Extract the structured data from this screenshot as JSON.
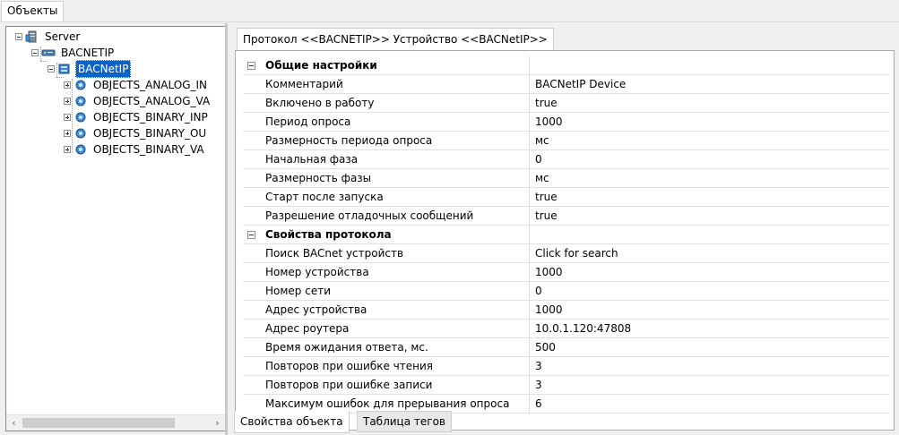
{
  "top_tab": {
    "label": "Объекты"
  },
  "tree": {
    "root": "Server",
    "protocol": "BACNETIP",
    "device": "BACNetIP",
    "children": [
      "OBJECTS_ANALOG_IN",
      "OBJECTS_ANALOG_VA",
      "OBJECTS_BINARY_INP",
      "OBJECTS_BINARY_OU",
      "OBJECTS_BINARY_VA"
    ]
  },
  "right": {
    "tab_label": "Протокол <<BACNETIP>> Устройство <<BACNetIP>>",
    "sections": [
      {
        "title": "Общие настройки",
        "rows": [
          {
            "key": "Комментарий",
            "value": "BACNetIP Device"
          },
          {
            "key": "Включено в работу",
            "value": "true"
          },
          {
            "key": "Период опроса",
            "value": "1000"
          },
          {
            "key": "Размерность периода опроса",
            "value": "мс"
          },
          {
            "key": "Начальная фаза",
            "value": "0"
          },
          {
            "key": "Размерность фазы",
            "value": "мс"
          },
          {
            "key": "Старт после запуска",
            "value": "true"
          },
          {
            "key": "Разрешение отладочных сообщений",
            "value": "true"
          }
        ]
      },
      {
        "title": "Свойства протокола",
        "rows": [
          {
            "key": "Поиск BACnet устройств",
            "value": "Click for search"
          },
          {
            "key": "Номер устройства",
            "value": "1000"
          },
          {
            "key": "Номер сети",
            "value": "0"
          },
          {
            "key": "Адрес устройства",
            "value": "1000"
          },
          {
            "key": "Адрес роутера",
            "value": "10.0.1.120:47808"
          },
          {
            "key": "Время ожидания ответа, мс.",
            "value": "500"
          },
          {
            "key": "Повторов при ошибке чтения",
            "value": "3"
          },
          {
            "key": "Повторов при ошибке записи",
            "value": "3"
          },
          {
            "key": "Максимум ошибок для прерывания опроса",
            "value": "6"
          }
        ]
      }
    ],
    "bottom_tabs": [
      "Свойства объекта",
      "Таблица тегов"
    ]
  },
  "colors": {
    "selection": "#0a64c8",
    "panel_bg": "#f0f0f0"
  }
}
